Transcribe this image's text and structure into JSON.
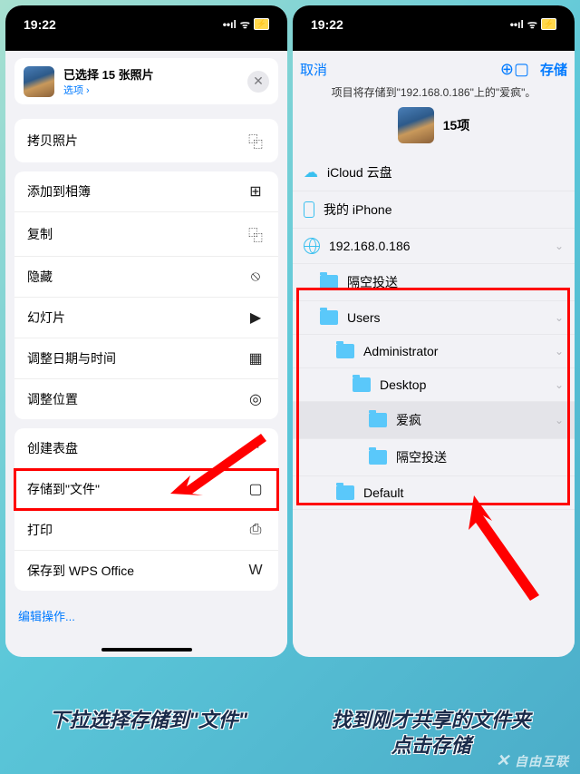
{
  "status": {
    "time": "19:22",
    "signal": "▮▯",
    "wifi": "⎋",
    "battery": "⚡︎"
  },
  "left": {
    "header_title": "已选择 15 张照片",
    "header_sub": "选项 ›",
    "actions": [
      {
        "label": "拷贝照片",
        "icon": "⿻"
      },
      {
        "label": "添加到相簿",
        "icon": "⊞"
      },
      {
        "label": "复制",
        "icon": "⿻"
      },
      {
        "label": "隐藏",
        "icon": "⦸"
      },
      {
        "label": "幻灯片",
        "icon": "▶"
      },
      {
        "label": "调整日期与时间",
        "icon": "▦"
      },
      {
        "label": "调整位置",
        "icon": "◎"
      },
      {
        "label": "创建表盘",
        "icon": "◓"
      },
      {
        "label": "存储到\"文件\"",
        "icon": "▢"
      },
      {
        "label": "打印",
        "icon": "⎙"
      },
      {
        "label": "保存到 WPS Office",
        "icon": "W"
      }
    ],
    "edit": "编辑操作..."
  },
  "right": {
    "cancel": "取消",
    "save": "存储",
    "description": "项目将存储到\"192.168.0.186\"上的\"爱疯\"。",
    "count": "15项",
    "locations": {
      "icloud": "iCloud 云盘",
      "iphone": "我的 iPhone",
      "ip": "192.168.0.186",
      "airdrop1": "隔空投送",
      "users": "Users",
      "admin": "Administrator",
      "desktop": "Desktop",
      "aifeng": "爱疯",
      "airdrop2": "隔空投送",
      "default": "Default"
    }
  },
  "captions": {
    "left": "下拉选择存储到\"文件\"",
    "right": "找到刚才共享的文件夹\n点击存储"
  },
  "watermark": "自由互联"
}
